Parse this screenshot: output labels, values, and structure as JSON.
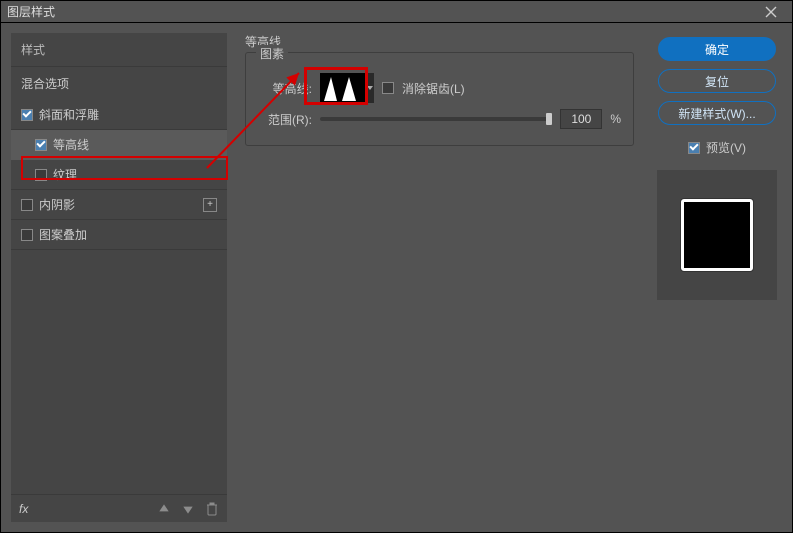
{
  "titlebar": {
    "title": "图层样式"
  },
  "left": {
    "styles_header": "样式",
    "blend_options": "混合选项",
    "items": [
      {
        "label": "斜面和浮雕",
        "checked": true,
        "indent": false,
        "plus": false
      },
      {
        "label": "等高线",
        "checked": true,
        "indent": true,
        "plus": false,
        "selected": true
      },
      {
        "label": "纹理",
        "checked": false,
        "indent": true,
        "plus": false
      },
      {
        "label": "内阴影",
        "checked": false,
        "indent": false,
        "plus": true
      },
      {
        "label": "图案叠加",
        "checked": false,
        "indent": false,
        "plus": false
      }
    ],
    "fx": "fx"
  },
  "center": {
    "section": "等高线",
    "group": "图素",
    "contour_label": "等高线:",
    "antialias": "消除锯齿(L)",
    "range_label": "范围(R):",
    "range_value": "100",
    "range_unit": "%"
  },
  "right": {
    "ok": "确定",
    "reset": "复位",
    "new_style": "新建样式(W)...",
    "preview": "预览(V)",
    "preview_checked": true
  }
}
